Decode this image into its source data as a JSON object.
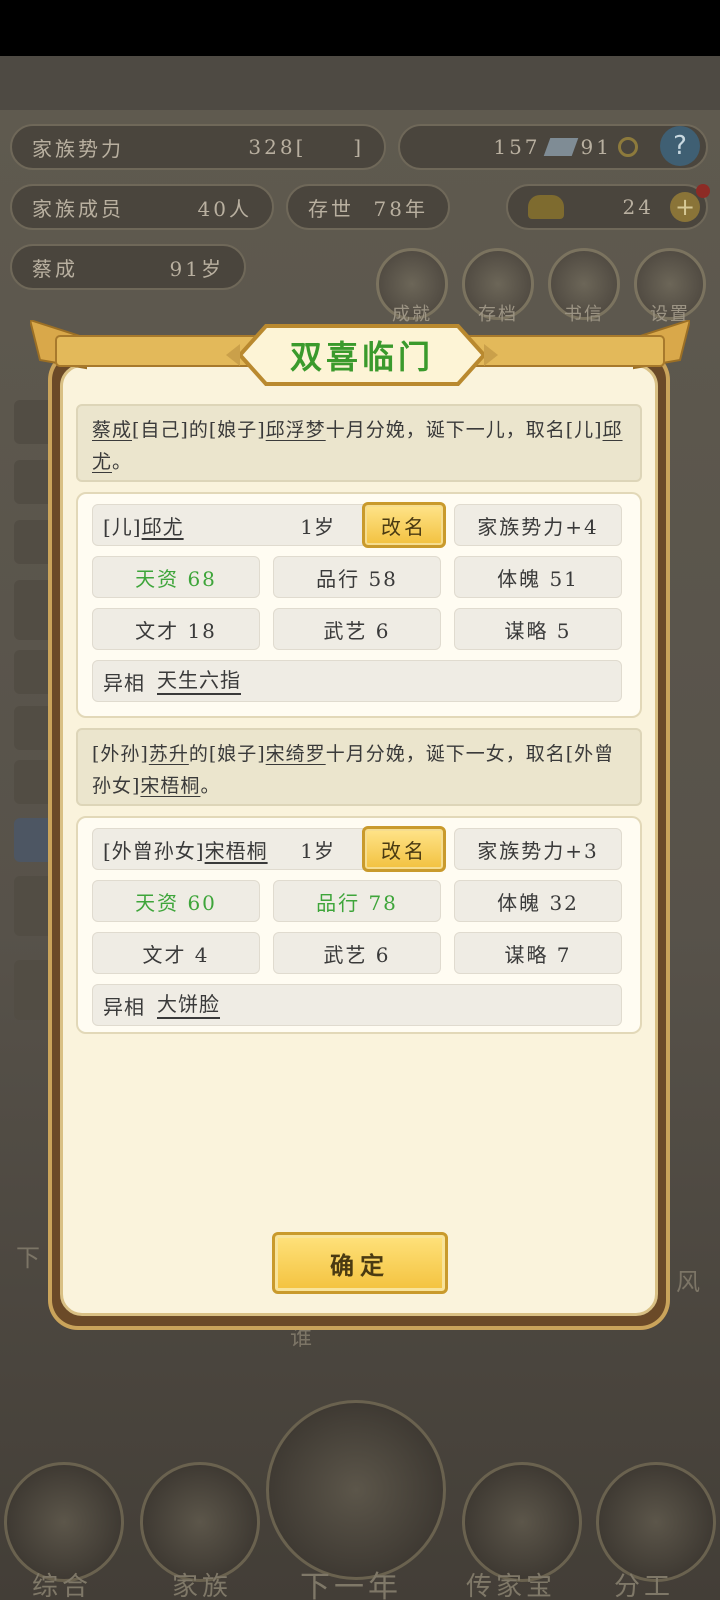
{
  "background": {
    "stats": {
      "family_power_label": "家族势力",
      "family_power_value": "328",
      "family_power_bracket_open": "[",
      "family_power_bracket_close": "]",
      "resource_a": "157",
      "resource_b": "91",
      "members_label": "家族成员",
      "members_value": "40人",
      "existence_label": "存世",
      "existence_value": "78年",
      "gold_value": "24",
      "leader_name": "蔡成",
      "leader_age": "91岁"
    },
    "menu": {
      "achievements": "成就",
      "archive": "存档",
      "letters": "书信",
      "settings": "设置"
    },
    "side_chars": [
      "下",
      "风",
      "谁"
    ],
    "nav": {
      "overview": "综合",
      "family": "家族",
      "next_year": "下一年",
      "heirloom": "传家宝",
      "assignment": "分工"
    }
  },
  "modal": {
    "title": "双喜临门",
    "announcements": [
      {
        "parts": [
          {
            "t": "蔡成",
            "u": true
          },
          {
            "t": "[自己]的[娘子]",
            "u": false
          },
          {
            "t": "邱浮梦",
            "u": true
          },
          {
            "t": "十月分娩，诞下一儿，取名[儿]",
            "u": false
          },
          {
            "t": "邱尤",
            "u": true
          },
          {
            "t": "。",
            "u": false
          }
        ]
      },
      {
        "parts": [
          {
            "t": "[外孙]",
            "u": false
          },
          {
            "t": "苏升",
            "u": true
          },
          {
            "t": "的[娘子]",
            "u": false
          },
          {
            "t": "宋绮罗",
            "u": true
          },
          {
            "t": "十月分娩，诞下一女，取名[外曾孙女]",
            "u": false
          },
          {
            "t": "宋梧桐",
            "u": true
          },
          {
            "t": "。",
            "u": false
          }
        ]
      }
    ],
    "children": [
      {
        "relation": "[儿]",
        "name": "邱尤",
        "age": "1岁",
        "rename": "改名",
        "power": "家族势力+4",
        "talent": "天资 68",
        "character": "品行 58",
        "physique": "体魄 51",
        "literary": "文才 18",
        "martial": "武艺 6",
        "strategy": "谋略 5",
        "trait_label": "异相",
        "trait_value": "天生六指"
      },
      {
        "relation": "[外曾孙女]",
        "name": "宋梧桐",
        "age": "1岁",
        "rename": "改名",
        "power": "家族势力+3",
        "talent": "天资 60",
        "character": "品行 78",
        "physique": "体魄 32",
        "literary": "文才 4",
        "martial": "武艺 6",
        "strategy": "谋略 7",
        "trait_label": "异相",
        "trait_value": "大饼脸"
      }
    ],
    "confirm": "确定"
  },
  "colors": {
    "title_green": "#3a9a2c",
    "stat_green": "#3ea53a",
    "gold_button": "#f3c23e",
    "frame_brown": "#6b4a28"
  }
}
